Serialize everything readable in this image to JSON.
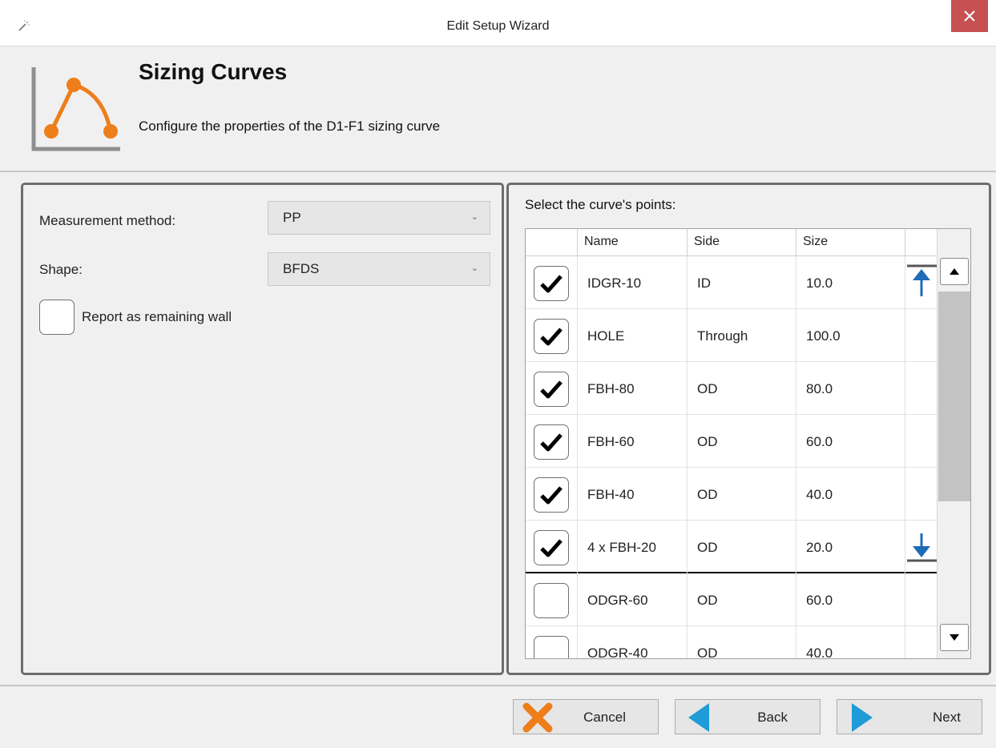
{
  "window": {
    "title": "Edit Setup Wizard",
    "close_icon": "close-icon",
    "app_icon": "magic-wand-icon"
  },
  "header": {
    "title": "Sizing Curves",
    "subtitle": "Configure the properties of the D1-F1 sizing curve",
    "icon": "sizing-curve-icon",
    "accent_color": "#ee7e1a"
  },
  "settings": {
    "measurement_method_label": "Measurement method:",
    "measurement_method_value": "PP",
    "shape_label": "Shape:",
    "shape_value": "BFDS",
    "remaining_wall_label": "Report as remaining wall",
    "remaining_wall_checked": false
  },
  "points": {
    "title": "Select the curve's points:",
    "columns": [
      "Name",
      "Side",
      "Size"
    ],
    "rows": [
      {
        "checked": true,
        "name": "IDGR-10",
        "side": "ID",
        "size": "10.0"
      },
      {
        "checked": true,
        "name": "HOLE",
        "side": "Through",
        "size": "100.0"
      },
      {
        "checked": true,
        "name": "FBH-80",
        "side": "OD",
        "size": "80.0"
      },
      {
        "checked": true,
        "name": "FBH-60",
        "side": "OD",
        "size": "60.0"
      },
      {
        "checked": true,
        "name": "FBH-40",
        "side": "OD",
        "size": "40.0"
      },
      {
        "checked": true,
        "name": "4 x FBH-20",
        "side": "OD",
        "size": "20.0"
      },
      {
        "checked": false,
        "name": "ODGR-60",
        "side": "OD",
        "size": "60.0"
      },
      {
        "checked": false,
        "name": "ODGR-40",
        "side": "OD",
        "size": "40.0"
      }
    ],
    "move_up_icon": "move-to-top-icon",
    "move_down_icon": "move-to-bottom-icon",
    "arrow_color": "#1e6bb8"
  },
  "footer": {
    "cancel_label": "Cancel",
    "back_label": "Back",
    "next_label": "Next",
    "cancel_icon_color": "#ee7e1a",
    "nav_icon_color": "#1f9bd7"
  }
}
